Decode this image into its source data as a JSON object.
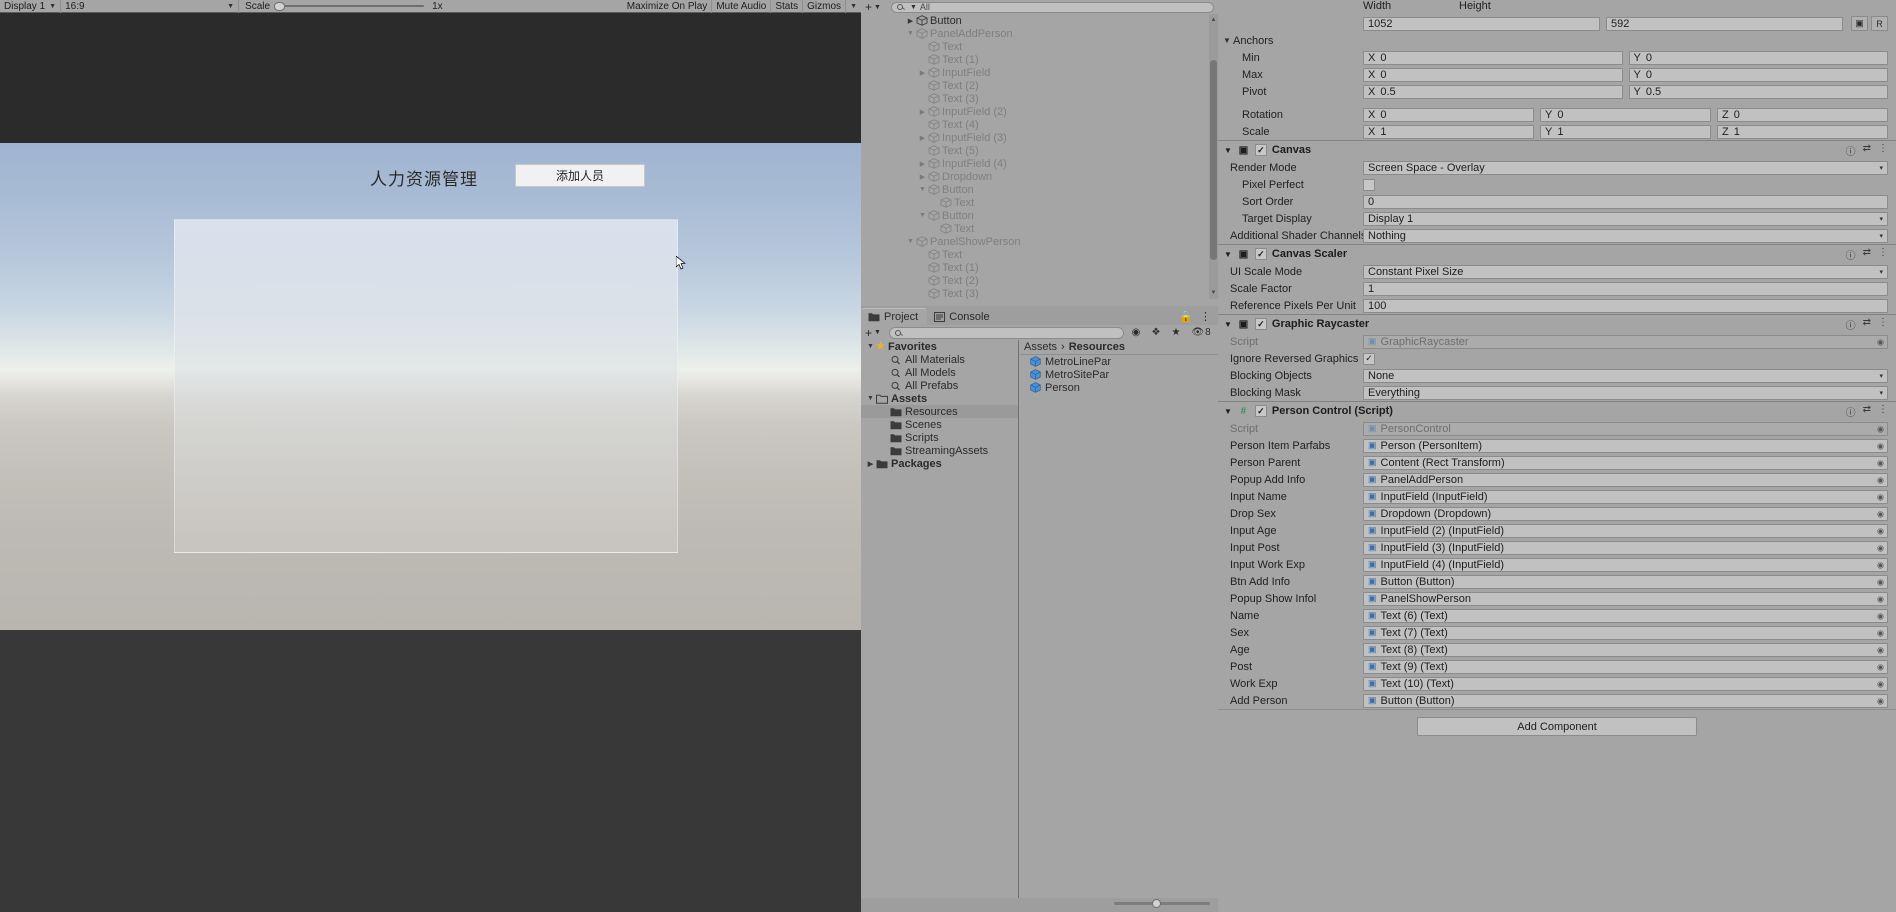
{
  "game_toolbar": {
    "display": "Display 1",
    "aspect": "16:9",
    "scale_label": "Scale",
    "scale_value": "1x",
    "maximize_on_play": "Maximize On Play",
    "mute_audio": "Mute Audio",
    "stats": "Stats",
    "gizmos": "Gizmos"
  },
  "game_view": {
    "title": "人力资源管理",
    "add_person_button": "添加人员"
  },
  "hierarchy": {
    "search_placeholder": "All",
    "items": [
      {
        "label": "Button",
        "indent": 3,
        "arrow": "right",
        "active": true
      },
      {
        "label": "PanelAddPerson",
        "indent": 3,
        "arrow": "down",
        "active": false
      },
      {
        "label": "Text",
        "indent": 4,
        "arrow": "none",
        "active": false
      },
      {
        "label": "Text (1)",
        "indent": 4,
        "arrow": "none",
        "active": false
      },
      {
        "label": "InputField",
        "indent": 4,
        "arrow": "right",
        "active": false
      },
      {
        "label": "Text (2)",
        "indent": 4,
        "arrow": "none",
        "active": false
      },
      {
        "label": "Text (3)",
        "indent": 4,
        "arrow": "none",
        "active": false
      },
      {
        "label": "InputField (2)",
        "indent": 4,
        "arrow": "right",
        "active": false
      },
      {
        "label": "Text (4)",
        "indent": 4,
        "arrow": "none",
        "active": false
      },
      {
        "label": "InputField (3)",
        "indent": 4,
        "arrow": "right",
        "active": false
      },
      {
        "label": "Text (5)",
        "indent": 4,
        "arrow": "none",
        "active": false
      },
      {
        "label": "InputField (4)",
        "indent": 4,
        "arrow": "right",
        "active": false
      },
      {
        "label": "Dropdown",
        "indent": 4,
        "arrow": "right",
        "active": false
      },
      {
        "label": "Button",
        "indent": 4,
        "arrow": "down",
        "active": false
      },
      {
        "label": "Text",
        "indent": 5,
        "arrow": "none",
        "active": false
      },
      {
        "label": "Button",
        "indent": 4,
        "arrow": "down",
        "active": false
      },
      {
        "label": "Text",
        "indent": 5,
        "arrow": "none",
        "active": false
      },
      {
        "label": "PanelShowPerson",
        "indent": 3,
        "arrow": "down",
        "active": false
      },
      {
        "label": "Text",
        "indent": 4,
        "arrow": "none",
        "active": false
      },
      {
        "label": "Text (1)",
        "indent": 4,
        "arrow": "none",
        "active": false
      },
      {
        "label": "Text (2)",
        "indent": 4,
        "arrow": "none",
        "active": false
      },
      {
        "label": "Text (3)",
        "indent": 4,
        "arrow": "none",
        "active": false
      }
    ]
  },
  "project": {
    "tabs": [
      {
        "label": "Project",
        "active": true
      },
      {
        "label": "Console",
        "active": false
      }
    ],
    "search_placeholder": "",
    "hidden_count": "8",
    "tree": [
      {
        "label": "Favorites",
        "type": "favorites",
        "indent": 0,
        "arrow": "down",
        "bold": true,
        "selected": false
      },
      {
        "label": "All Materials",
        "type": "search",
        "indent": 1,
        "arrow": "none",
        "bold": false,
        "selected": false
      },
      {
        "label": "All Models",
        "type": "search",
        "indent": 1,
        "arrow": "none",
        "bold": false,
        "selected": false
      },
      {
        "label": "All Prefabs",
        "type": "search",
        "indent": 1,
        "arrow": "none",
        "bold": false,
        "selected": false
      },
      {
        "label": "Assets",
        "type": "folder-open",
        "indent": 0,
        "arrow": "down",
        "bold": true,
        "selected": false
      },
      {
        "label": "Resources",
        "type": "folder",
        "indent": 1,
        "arrow": "none",
        "bold": false,
        "selected": true
      },
      {
        "label": "Scenes",
        "type": "folder",
        "indent": 1,
        "arrow": "none",
        "bold": false,
        "selected": false
      },
      {
        "label": "Scripts",
        "type": "folder",
        "indent": 1,
        "arrow": "none",
        "bold": false,
        "selected": false
      },
      {
        "label": "StreamingAssets",
        "type": "folder",
        "indent": 1,
        "arrow": "none",
        "bold": false,
        "selected": false
      },
      {
        "label": "Packages",
        "type": "folder",
        "indent": 0,
        "arrow": "right",
        "bold": true,
        "selected": false
      }
    ],
    "breadcrumb": [
      "Assets",
      "Resources"
    ],
    "assets": [
      {
        "label": "MetroLinePar",
        "type": "prefab"
      },
      {
        "label": "MetroSitePar",
        "type": "prefab"
      },
      {
        "label": "Person",
        "type": "prefab"
      }
    ]
  },
  "inspector": {
    "rect_transform": {
      "width_label": "Width",
      "width_value": "1052",
      "height_label": "Height",
      "height_value": "592",
      "blueprint_icon": "blueprint-mode-icon",
      "raw_edit_icon": "R",
      "anchors_label": "Anchors",
      "min_label": "Min",
      "min_x": "0",
      "min_y": "0",
      "max_label": "Max",
      "max_x": "0",
      "max_y": "0",
      "pivot_label": "Pivot",
      "pivot_x": "0.5",
      "pivot_y": "0.5",
      "rotation_label": "Rotation",
      "rotation_x": "0",
      "rotation_y": "0",
      "rotation_z": "0",
      "scale_label": "Scale",
      "scale_x": "1",
      "scale_y": "1",
      "scale_z": "1"
    },
    "canvas": {
      "title": "Canvas",
      "enabled": true,
      "rows": [
        {
          "label": "Render Mode",
          "value": "Screen Space - Overlay",
          "kind": "dropdown",
          "indent": 0
        },
        {
          "label": "Pixel Perfect",
          "value": "",
          "kind": "checkbox",
          "checked": false,
          "indent": 1
        },
        {
          "label": "Sort Order",
          "value": "0",
          "kind": "text",
          "indent": 1
        },
        {
          "label": "Target Display",
          "value": "Display 1",
          "kind": "dropdown",
          "indent": 1
        },
        {
          "label": "Additional Shader Channels",
          "value": "Nothing",
          "kind": "dropdown",
          "indent": 0
        }
      ]
    },
    "canvas_scaler": {
      "title": "Canvas Scaler",
      "enabled": true,
      "rows": [
        {
          "label": "UI Scale Mode",
          "value": "Constant Pixel Size",
          "kind": "dropdown",
          "indent": 0
        },
        {
          "label": "Scale Factor",
          "value": "1",
          "kind": "text",
          "indent": 0
        },
        {
          "label": "Reference Pixels Per Unit",
          "value": "100",
          "kind": "text",
          "indent": 0
        }
      ]
    },
    "graphic_raycaster": {
      "title": "Graphic Raycaster",
      "enabled": true,
      "rows": [
        {
          "label": "Script",
          "value": "GraphicRaycaster",
          "kind": "object-disabled",
          "indent": 0
        },
        {
          "label": "Ignore Reversed Graphics",
          "value": "",
          "kind": "checkbox",
          "checked": true,
          "indent": 0
        },
        {
          "label": "Blocking Objects",
          "value": "None",
          "kind": "dropdown",
          "indent": 0
        },
        {
          "label": "Blocking Mask",
          "value": "Everything",
          "kind": "dropdown",
          "indent": 0
        }
      ]
    },
    "person_control": {
      "title": "Person Control (Script)",
      "enabled": true,
      "rows": [
        {
          "label": "Script",
          "value": "PersonControl",
          "kind": "object-disabled",
          "indent": 0
        },
        {
          "label": "Person Item Parfabs",
          "value": "Person (PersonItem)",
          "kind": "object",
          "indent": 0
        },
        {
          "label": "Person Parent",
          "value": "Content (Rect Transform)",
          "kind": "object",
          "indent": 0
        },
        {
          "label": "Popup Add Info",
          "value": "PanelAddPerson",
          "kind": "object",
          "indent": 0
        },
        {
          "label": "Input Name",
          "value": "InputField (InputField)",
          "kind": "object",
          "indent": 0
        },
        {
          "label": "Drop Sex",
          "value": "Dropdown (Dropdown)",
          "kind": "object",
          "indent": 0
        },
        {
          "label": "Input Age",
          "value": "InputField (2) (InputField)",
          "kind": "object",
          "indent": 0
        },
        {
          "label": "Input Post",
          "value": "InputField (3) (InputField)",
          "kind": "object",
          "indent": 0
        },
        {
          "label": "Input Work Exp",
          "value": "InputField (4) (InputField)",
          "kind": "object",
          "indent": 0
        },
        {
          "label": "Btn Add Info",
          "value": "Button (Button)",
          "kind": "object",
          "indent": 0
        },
        {
          "label": "Popup Show Infol",
          "value": "PanelShowPerson",
          "kind": "object",
          "indent": 0
        },
        {
          "label": "Name",
          "value": "Text (6) (Text)",
          "kind": "object",
          "indent": 0
        },
        {
          "label": "Sex",
          "value": "Text (7) (Text)",
          "kind": "object",
          "indent": 0
        },
        {
          "label": "Age",
          "value": "Text (8) (Text)",
          "kind": "object",
          "indent": 0
        },
        {
          "label": "Post",
          "value": "Text (9) (Text)",
          "kind": "object",
          "indent": 0
        },
        {
          "label": "Work Exp",
          "value": "Text (10) (Text)",
          "kind": "object",
          "indent": 0
        },
        {
          "label": "Add Person",
          "value": "Button (Button)",
          "kind": "object",
          "indent": 0
        }
      ]
    },
    "add_component_label": "Add Component"
  }
}
